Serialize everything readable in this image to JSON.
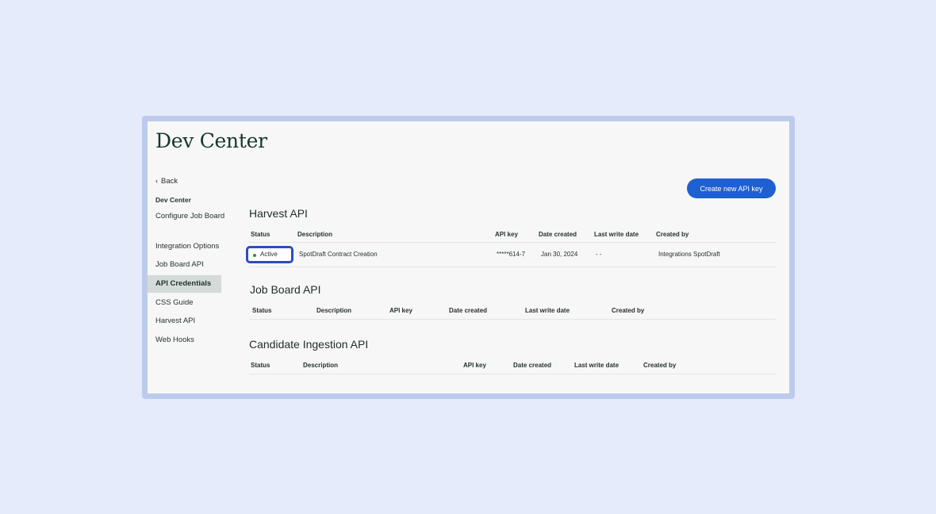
{
  "page": {
    "title": "Dev Center"
  },
  "sidebar": {
    "back_label": "Back",
    "heading": "Dev Center",
    "items": [
      {
        "label": "Configure Job Board"
      },
      {
        "label": "Integration Options"
      },
      {
        "label": "Job Board API"
      },
      {
        "label": "API Credentials",
        "active": true
      },
      {
        "label": "CSS Guide"
      },
      {
        "label": "Harvest API"
      },
      {
        "label": "Web Hooks"
      }
    ]
  },
  "actions": {
    "create_label": "Create new API key"
  },
  "sections": [
    {
      "title": "Harvest API",
      "columns": [
        "Status",
        "Description",
        "API key",
        "Date created",
        "Last write date",
        "Created by"
      ],
      "rows": [
        {
          "status": "Active",
          "description": "SpotDraft Contract Creation",
          "api_key": "*****614-7",
          "date_created": "Jan 30, 2024",
          "last_write_date": "- -",
          "created_by": "Integrations SpotDraft"
        }
      ]
    },
    {
      "title": "Job Board API",
      "columns": [
        "Status",
        "Description",
        "API key",
        "Date created",
        "Last write date",
        "Created by"
      ],
      "rows": []
    },
    {
      "title": "Candidate Ingestion API",
      "columns": [
        "Status",
        "Description",
        "API key",
        "Date created",
        "Last write date",
        "Created by"
      ],
      "rows": []
    }
  ],
  "colors": {
    "accent": "#1e5fd2",
    "highlight": "#2b4dbf",
    "active_dot": "#2f8a4f",
    "frame": "#bccbec"
  }
}
